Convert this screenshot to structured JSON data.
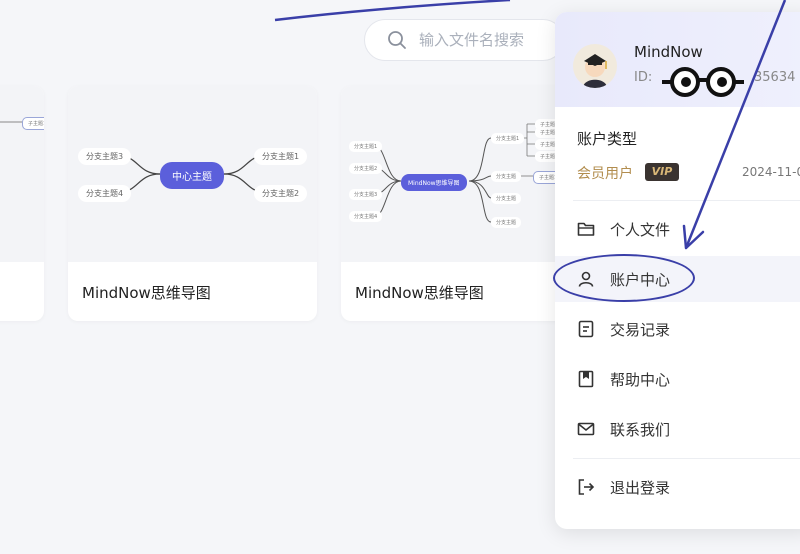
{
  "search": {
    "placeholder": "输入文件名搜索"
  },
  "cards": [
    {
      "name": "",
      "thumb": {
        "labels": [
          "子主题1"
        ]
      }
    },
    {
      "name": "MindNow思维导图",
      "thumb": {
        "center": "中心主题",
        "branches": [
          "分支主题3",
          "分支主题1",
          "分支主题4",
          "分支主题2"
        ]
      }
    },
    {
      "name": "MindNow思维导图",
      "thumb": {
        "center": "MindNow思维导图",
        "branches": [
          "分支主题1",
          "分支主题2",
          "分支主题3",
          "分支主题4",
          "分支主题1",
          "分支主题",
          "分支主题",
          "分支主题"
        ],
        "sub": [
          "子主题1",
          "子主题2",
          "子主题3",
          "子主题4",
          "子主题1"
        ]
      }
    }
  ],
  "account_panel": {
    "username": "MindNow",
    "id_label": "ID:",
    "id_value": "35634",
    "account_type_label": "账户类型",
    "membership": "会员用户",
    "vip_badge": "VIP",
    "expiry": "2024-11-0",
    "menu": [
      {
        "label": "个人文件",
        "icon": "folder-icon"
      },
      {
        "label": "账户中心",
        "icon": "user-icon",
        "active": true
      },
      {
        "label": "交易记录",
        "icon": "receipt-icon"
      },
      {
        "label": "帮助中心",
        "icon": "bookmark-icon"
      },
      {
        "label": "联系我们",
        "icon": "mail-icon"
      }
    ],
    "logout": {
      "label": "退出登录",
      "icon": "logout-icon"
    }
  },
  "colors": {
    "accent": "#5b5fdb",
    "annotation": "#3a3fa8",
    "vip_gold": "#b28d4e"
  }
}
